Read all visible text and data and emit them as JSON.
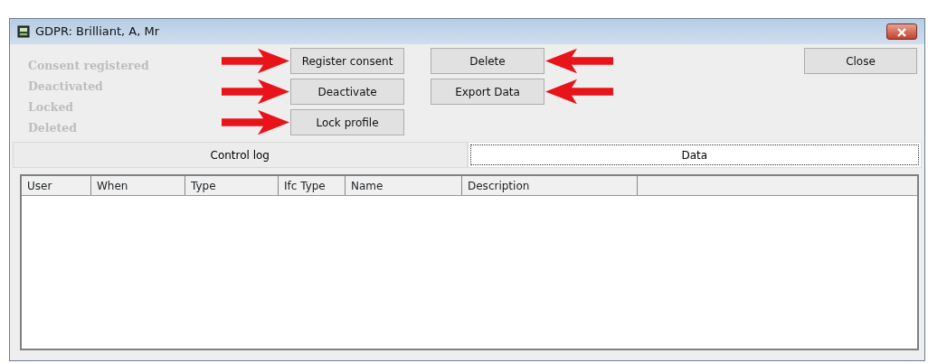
{
  "window": {
    "title": "GDPR: Brilliant, A, Mr"
  },
  "statuses": [
    {
      "label": "Consent registered",
      "active": false
    },
    {
      "label": "Deactivated",
      "active": false
    },
    {
      "label": "Locked",
      "active": false
    },
    {
      "label": "Deleted",
      "active": false
    }
  ],
  "action_buttons": [
    {
      "label": "Register consent",
      "arrowed": true
    },
    {
      "label": "Deactivate",
      "arrowed": true
    },
    {
      "label": "Lock profile",
      "arrowed": true
    }
  ],
  "data_buttons": [
    {
      "label": "Delete",
      "arrowed": true
    },
    {
      "label": "Export Data",
      "arrowed": true
    }
  ],
  "close_button": {
    "label": "Close"
  },
  "tabs": [
    {
      "label": "Control log",
      "selected": false
    },
    {
      "label": "Data",
      "selected": true
    }
  ],
  "table": {
    "columns": [
      "User",
      "When",
      "Type",
      "Ifc Type",
      "Name",
      "Description"
    ]
  }
}
